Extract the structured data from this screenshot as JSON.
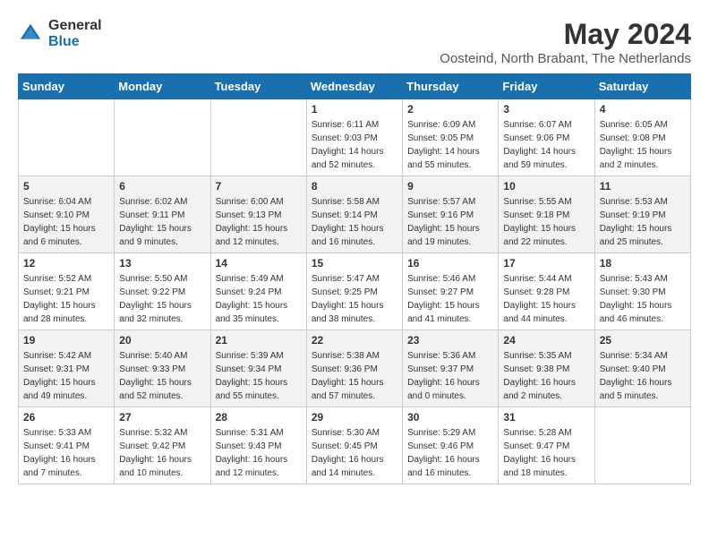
{
  "logo": {
    "general": "General",
    "blue": "Blue"
  },
  "title": "May 2024",
  "location": "Oosteind, North Brabant, The Netherlands",
  "days_of_week": [
    "Sunday",
    "Monday",
    "Tuesday",
    "Wednesday",
    "Thursday",
    "Friday",
    "Saturday"
  ],
  "weeks": [
    [
      {
        "day": "",
        "sunrise": "",
        "sunset": "",
        "daylight": ""
      },
      {
        "day": "",
        "sunrise": "",
        "sunset": "",
        "daylight": ""
      },
      {
        "day": "",
        "sunrise": "",
        "sunset": "",
        "daylight": ""
      },
      {
        "day": "1",
        "sunrise": "Sunrise: 6:11 AM",
        "sunset": "Sunset: 9:03 PM",
        "daylight": "Daylight: 14 hours and 52 minutes."
      },
      {
        "day": "2",
        "sunrise": "Sunrise: 6:09 AM",
        "sunset": "Sunset: 9:05 PM",
        "daylight": "Daylight: 14 hours and 55 minutes."
      },
      {
        "day": "3",
        "sunrise": "Sunrise: 6:07 AM",
        "sunset": "Sunset: 9:06 PM",
        "daylight": "Daylight: 14 hours and 59 minutes."
      },
      {
        "day": "4",
        "sunrise": "Sunrise: 6:05 AM",
        "sunset": "Sunset: 9:08 PM",
        "daylight": "Daylight: 15 hours and 2 minutes."
      }
    ],
    [
      {
        "day": "5",
        "sunrise": "Sunrise: 6:04 AM",
        "sunset": "Sunset: 9:10 PM",
        "daylight": "Daylight: 15 hours and 6 minutes."
      },
      {
        "day": "6",
        "sunrise": "Sunrise: 6:02 AM",
        "sunset": "Sunset: 9:11 PM",
        "daylight": "Daylight: 15 hours and 9 minutes."
      },
      {
        "day": "7",
        "sunrise": "Sunrise: 6:00 AM",
        "sunset": "Sunset: 9:13 PM",
        "daylight": "Daylight: 15 hours and 12 minutes."
      },
      {
        "day": "8",
        "sunrise": "Sunrise: 5:58 AM",
        "sunset": "Sunset: 9:14 PM",
        "daylight": "Daylight: 15 hours and 16 minutes."
      },
      {
        "day": "9",
        "sunrise": "Sunrise: 5:57 AM",
        "sunset": "Sunset: 9:16 PM",
        "daylight": "Daylight: 15 hours and 19 minutes."
      },
      {
        "day": "10",
        "sunrise": "Sunrise: 5:55 AM",
        "sunset": "Sunset: 9:18 PM",
        "daylight": "Daylight: 15 hours and 22 minutes."
      },
      {
        "day": "11",
        "sunrise": "Sunrise: 5:53 AM",
        "sunset": "Sunset: 9:19 PM",
        "daylight": "Daylight: 15 hours and 25 minutes."
      }
    ],
    [
      {
        "day": "12",
        "sunrise": "Sunrise: 5:52 AM",
        "sunset": "Sunset: 9:21 PM",
        "daylight": "Daylight: 15 hours and 28 minutes."
      },
      {
        "day": "13",
        "sunrise": "Sunrise: 5:50 AM",
        "sunset": "Sunset: 9:22 PM",
        "daylight": "Daylight: 15 hours and 32 minutes."
      },
      {
        "day": "14",
        "sunrise": "Sunrise: 5:49 AM",
        "sunset": "Sunset: 9:24 PM",
        "daylight": "Daylight: 15 hours and 35 minutes."
      },
      {
        "day": "15",
        "sunrise": "Sunrise: 5:47 AM",
        "sunset": "Sunset: 9:25 PM",
        "daylight": "Daylight: 15 hours and 38 minutes."
      },
      {
        "day": "16",
        "sunrise": "Sunrise: 5:46 AM",
        "sunset": "Sunset: 9:27 PM",
        "daylight": "Daylight: 15 hours and 41 minutes."
      },
      {
        "day": "17",
        "sunrise": "Sunrise: 5:44 AM",
        "sunset": "Sunset: 9:28 PM",
        "daylight": "Daylight: 15 hours and 44 minutes."
      },
      {
        "day": "18",
        "sunrise": "Sunrise: 5:43 AM",
        "sunset": "Sunset: 9:30 PM",
        "daylight": "Daylight: 15 hours and 46 minutes."
      }
    ],
    [
      {
        "day": "19",
        "sunrise": "Sunrise: 5:42 AM",
        "sunset": "Sunset: 9:31 PM",
        "daylight": "Daylight: 15 hours and 49 minutes."
      },
      {
        "day": "20",
        "sunrise": "Sunrise: 5:40 AM",
        "sunset": "Sunset: 9:33 PM",
        "daylight": "Daylight: 15 hours and 52 minutes."
      },
      {
        "day": "21",
        "sunrise": "Sunrise: 5:39 AM",
        "sunset": "Sunset: 9:34 PM",
        "daylight": "Daylight: 15 hours and 55 minutes."
      },
      {
        "day": "22",
        "sunrise": "Sunrise: 5:38 AM",
        "sunset": "Sunset: 9:36 PM",
        "daylight": "Daylight: 15 hours and 57 minutes."
      },
      {
        "day": "23",
        "sunrise": "Sunrise: 5:36 AM",
        "sunset": "Sunset: 9:37 PM",
        "daylight": "Daylight: 16 hours and 0 minutes."
      },
      {
        "day": "24",
        "sunrise": "Sunrise: 5:35 AM",
        "sunset": "Sunset: 9:38 PM",
        "daylight": "Daylight: 16 hours and 2 minutes."
      },
      {
        "day": "25",
        "sunrise": "Sunrise: 5:34 AM",
        "sunset": "Sunset: 9:40 PM",
        "daylight": "Daylight: 16 hours and 5 minutes."
      }
    ],
    [
      {
        "day": "26",
        "sunrise": "Sunrise: 5:33 AM",
        "sunset": "Sunset: 9:41 PM",
        "daylight": "Daylight: 16 hours and 7 minutes."
      },
      {
        "day": "27",
        "sunrise": "Sunrise: 5:32 AM",
        "sunset": "Sunset: 9:42 PM",
        "daylight": "Daylight: 16 hours and 10 minutes."
      },
      {
        "day": "28",
        "sunrise": "Sunrise: 5:31 AM",
        "sunset": "Sunset: 9:43 PM",
        "daylight": "Daylight: 16 hours and 12 minutes."
      },
      {
        "day": "29",
        "sunrise": "Sunrise: 5:30 AM",
        "sunset": "Sunset: 9:45 PM",
        "daylight": "Daylight: 16 hours and 14 minutes."
      },
      {
        "day": "30",
        "sunrise": "Sunrise: 5:29 AM",
        "sunset": "Sunset: 9:46 PM",
        "daylight": "Daylight: 16 hours and 16 minutes."
      },
      {
        "day": "31",
        "sunrise": "Sunrise: 5:28 AM",
        "sunset": "Sunset: 9:47 PM",
        "daylight": "Daylight: 16 hours and 18 minutes."
      },
      {
        "day": "",
        "sunrise": "",
        "sunset": "",
        "daylight": ""
      }
    ]
  ]
}
